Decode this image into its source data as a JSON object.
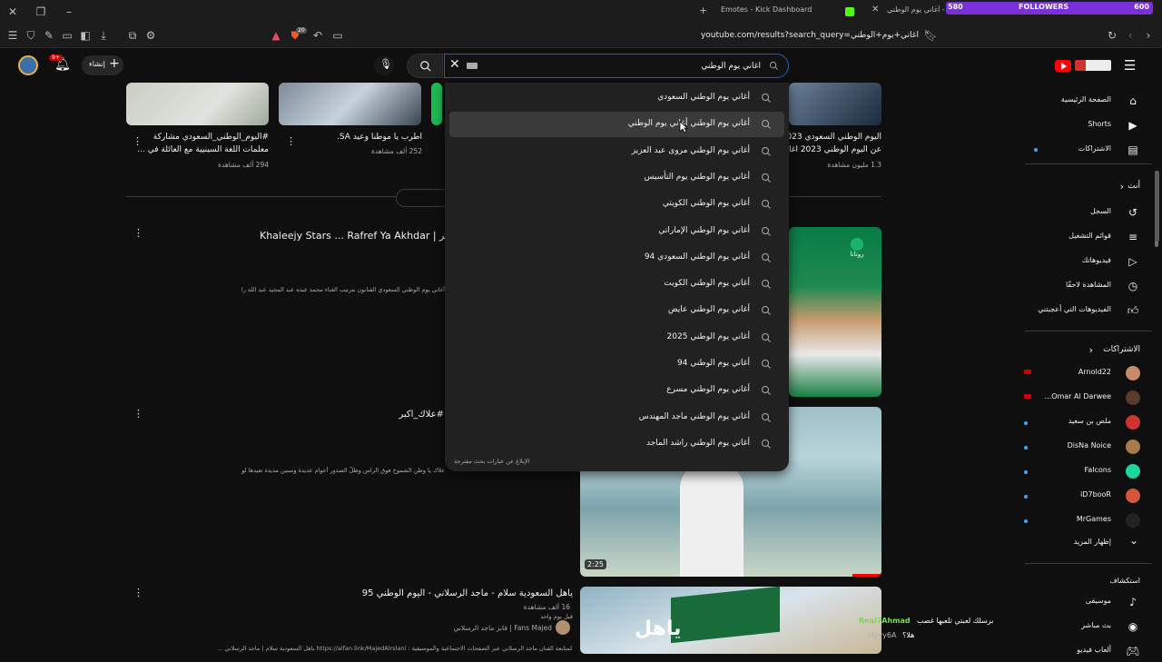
{
  "browser": {
    "tabs": [
      {
        "label": "Emotes - Kick Dashboard"
      },
      {
        "label": "YouTube - أغاني يوم الوطني"
      }
    ],
    "add_tab_symbol": "+",
    "url": "youtube.com/results?search_query=أغاني+يوم+الوطني",
    "stream_overlay": {
      "left_count": "580",
      "label": "FOLLOWERS",
      "right_count": "600"
    },
    "notification_count": "20"
  },
  "youtube": {
    "create_label": "إنشاء",
    "notifications_badge": "9+",
    "search": {
      "value": "أغاني يوم الوطني"
    },
    "dropdown": {
      "suggestions": [
        "أغاني يوم الوطني السعودي",
        "أغاني يوم الوطني أغاني يوم الوطني",
        "أغاني يوم الوطني مروى عبد العزيز",
        "أغاني يوم الوطني يوم التأسيس",
        "أغاني يوم الوطني الكويتي",
        "أغاني يوم الوطني الإماراتي",
        "أغاني يوم الوطني السعودي 94",
        "أغاني يوم الوطني الكويت",
        "أغاني يوم الوطني عايض",
        "أغاني يوم الوطني 2025",
        "أغاني يوم الوطني 94",
        "أغاني يوم الوطني مسرع",
        "أغاني يوم الوطني ماجد المهندس",
        "أغاني يوم الوطني راشد الماجد"
      ],
      "report_text": "الإبلاغ عن عبارات بحث مقترحة"
    },
    "shorts_row": [
      {
        "title_line1": "#اليوم_الوطني_السعودي مشاركة",
        "title_line2": "معلمات اللغة السينيية مع العائلة في ...",
        "views": "294 ألف مشاهدة"
      },
      {
        "title_line1": "اطرب يا موطنا وعيد SA.",
        "views": "252 ألف مشاهدة"
      },
      {
        "title_line1": "اليوم الوطني السعودي 2023",
        "title_line2": "عن اليوم الوطني 2023 اغاني",
        "views": "1.3 مليون مشاهدة"
      }
    ],
    "results": [
      {
        "title": "Khaleejy Stars ... Rafref Ya Akhdar | خليجي ستارز ... رفرف يا أخضر",
        "desc": "أغاني يوم الوطني السعودي الفنانون بترتيب الغناء محمد عبده عبد المجيد عبد الله راشد الماجد رابح ..."
      },
      {
        "title": "#علاك_اكبر",
        "desc": "علاك يا وطن الشموخ فوق الراس وظلّ الصدور أعوام عديدة وسنين مديدة تعيدها لوطننا الغالي كلمات: عاطف ..."
      },
      {
        "title": "ياهل السعودية سلام - ماجد الرسلاني - اليوم الوطني 95",
        "views": "16 ألف مشاهدة",
        "age": "قبل يوم واحد",
        "channel": "Fans Majed | فانز ماجد الرسلاني",
        "desc": "لمتابعة الفنان ماجد الرسلاني عبر الصفحات الاجتماعية والموسيقية : https://alfan.link/MajedAlrslani ياهل السعودية سلام | ماجد الرسلاني ..."
      }
    ],
    "thumbnail_badges": {
      "duration": "2:25",
      "mbc_text": "روتانا",
      "yahal_text": "ياهل"
    },
    "sidebar": {
      "main": [
        {
          "label": "الصفحة الرئيسية",
          "icon": "home-icon"
        },
        {
          "label": "Shorts",
          "icon": "shorts-icon"
        },
        {
          "label": "الاشتراكات",
          "icon": "subscriptions-icon"
        }
      ],
      "you_header": "أنت",
      "you": [
        {
          "label": "السجل",
          "icon": "history-icon"
        },
        {
          "label": "قوائم التشغيل",
          "icon": "playlists-icon"
        },
        {
          "label": "فيديوهاتك",
          "icon": "your-videos-icon"
        },
        {
          "label": "المشاهدة لاحقًا",
          "icon": "watch-later-icon"
        },
        {
          "label": "الفيديوهات التي أعجبتني",
          "icon": "liked-icon"
        }
      ],
      "subs_header": "الاشتراكات",
      "subs": [
        {
          "label": "Arnold22",
          "live": true,
          "color": "#c88b6b"
        },
        {
          "label": "Omar Al Darwee...",
          "live": true,
          "color": "#5a3a2a"
        },
        {
          "label": "ملص بن سعيد",
          "live": false,
          "color": "#c33"
        },
        {
          "label": "DisNa Noice",
          "live": false,
          "color": "#a87a4a"
        },
        {
          "label": "Falcons",
          "live": false,
          "color": "#1ad6a0"
        },
        {
          "label": "iD7booR",
          "live": false,
          "color": "#d4553b"
        },
        {
          "label": "MrGames",
          "live": false,
          "color": "#222"
        }
      ],
      "show_more": "إظهار المزيد",
      "explore_header": "استكشاف",
      "explore": [
        {
          "label": "موسيقى",
          "icon": "music-icon"
        },
        {
          "label": "بث مباشر",
          "icon": "live-icon"
        },
        {
          "label": "ألعاب فيديو",
          "icon": "gaming-icon"
        }
      ]
    },
    "chat_overlay": [
      {
        "user": "Real7Ahmad",
        "msg": "برسلك لعبتي تلعبها غصب"
      },
      {
        "user": "lilyyy6A",
        "msg": "هلا؟"
      }
    ]
  }
}
